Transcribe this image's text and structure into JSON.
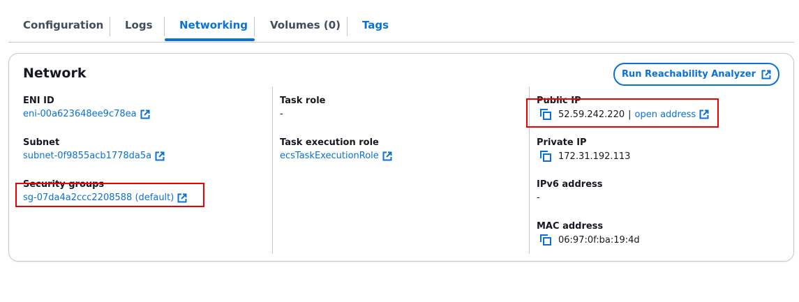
{
  "tabs": [
    {
      "label": "Configuration",
      "state": "default"
    },
    {
      "label": "Logs",
      "state": "default"
    },
    {
      "label": "Networking",
      "state": "active"
    },
    {
      "label": "Volumes (0)",
      "state": "default"
    },
    {
      "label": "Tags",
      "state": "link"
    }
  ],
  "network": {
    "title": "Network",
    "analyzer_button": "Run Reachability Analyzer",
    "eni": {
      "label": "ENI ID",
      "value": "eni-00a623648ee9c78ea"
    },
    "subnet": {
      "label": "Subnet",
      "value": "subnet-0f9855acb1778da5a"
    },
    "security_groups": {
      "label": "Security groups",
      "value": "sg-07da4a2ccc2208588 (default)"
    },
    "task_role": {
      "label": "Task role",
      "value": "-"
    },
    "task_execution_role": {
      "label": "Task execution role",
      "value": "ecsTaskExecutionRole"
    },
    "public_ip": {
      "label": "Public IP",
      "value": "52.59.242.220",
      "separator": "|",
      "link": "open address"
    },
    "private_ip": {
      "label": "Private IP",
      "value": "172.31.192.113"
    },
    "ipv6": {
      "label": "IPv6 address",
      "value": "-"
    },
    "mac": {
      "label": "MAC address",
      "value": "06:97:0f:ba:19:4d"
    }
  },
  "colors": {
    "accent": "#0972d3",
    "highlight": "#e00000"
  }
}
